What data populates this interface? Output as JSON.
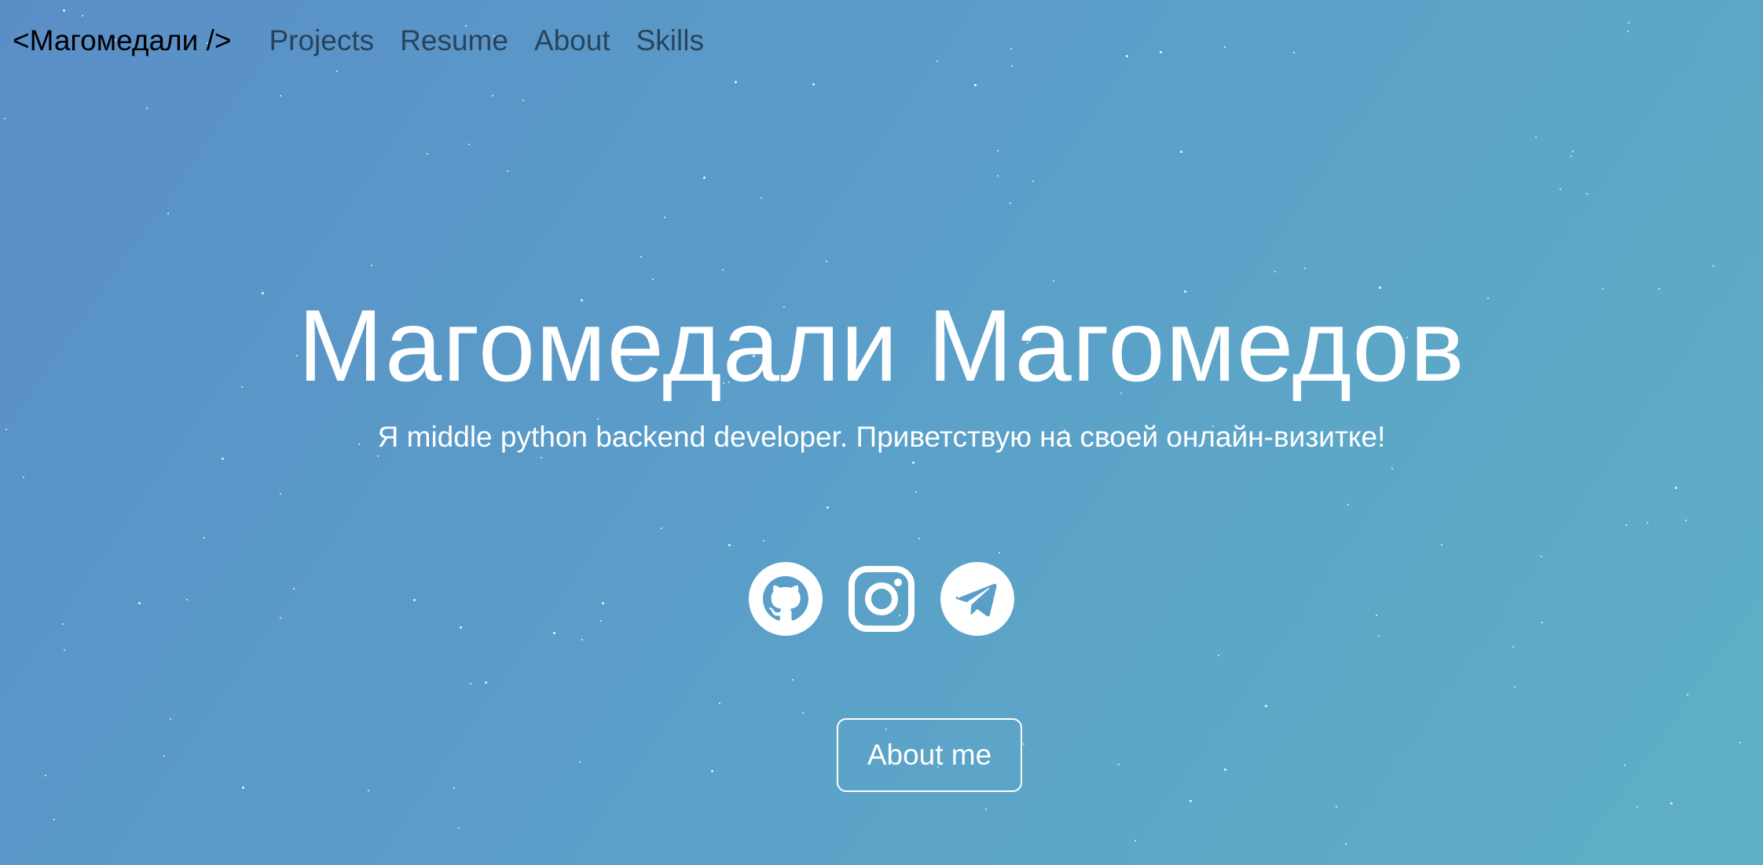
{
  "nav": {
    "brand": "<Магомедали />",
    "links": [
      {
        "label": "Projects"
      },
      {
        "label": "Resume"
      },
      {
        "label": "About"
      },
      {
        "label": "Skills"
      }
    ]
  },
  "hero": {
    "title": "Магомедали Магомедов",
    "subtitle": "Я middle python backend developer. Приветствую на своей онлайн-визитке!",
    "cta_label": "About me"
  },
  "socials": [
    {
      "icon": "github-icon"
    },
    {
      "icon": "instagram-icon"
    },
    {
      "icon": "telegram-icon"
    }
  ],
  "colors": {
    "gradient_start": "#5a8ec7",
    "gradient_end": "#5fb0c6",
    "text": "#ffffff",
    "nav_brand": "#000000"
  }
}
